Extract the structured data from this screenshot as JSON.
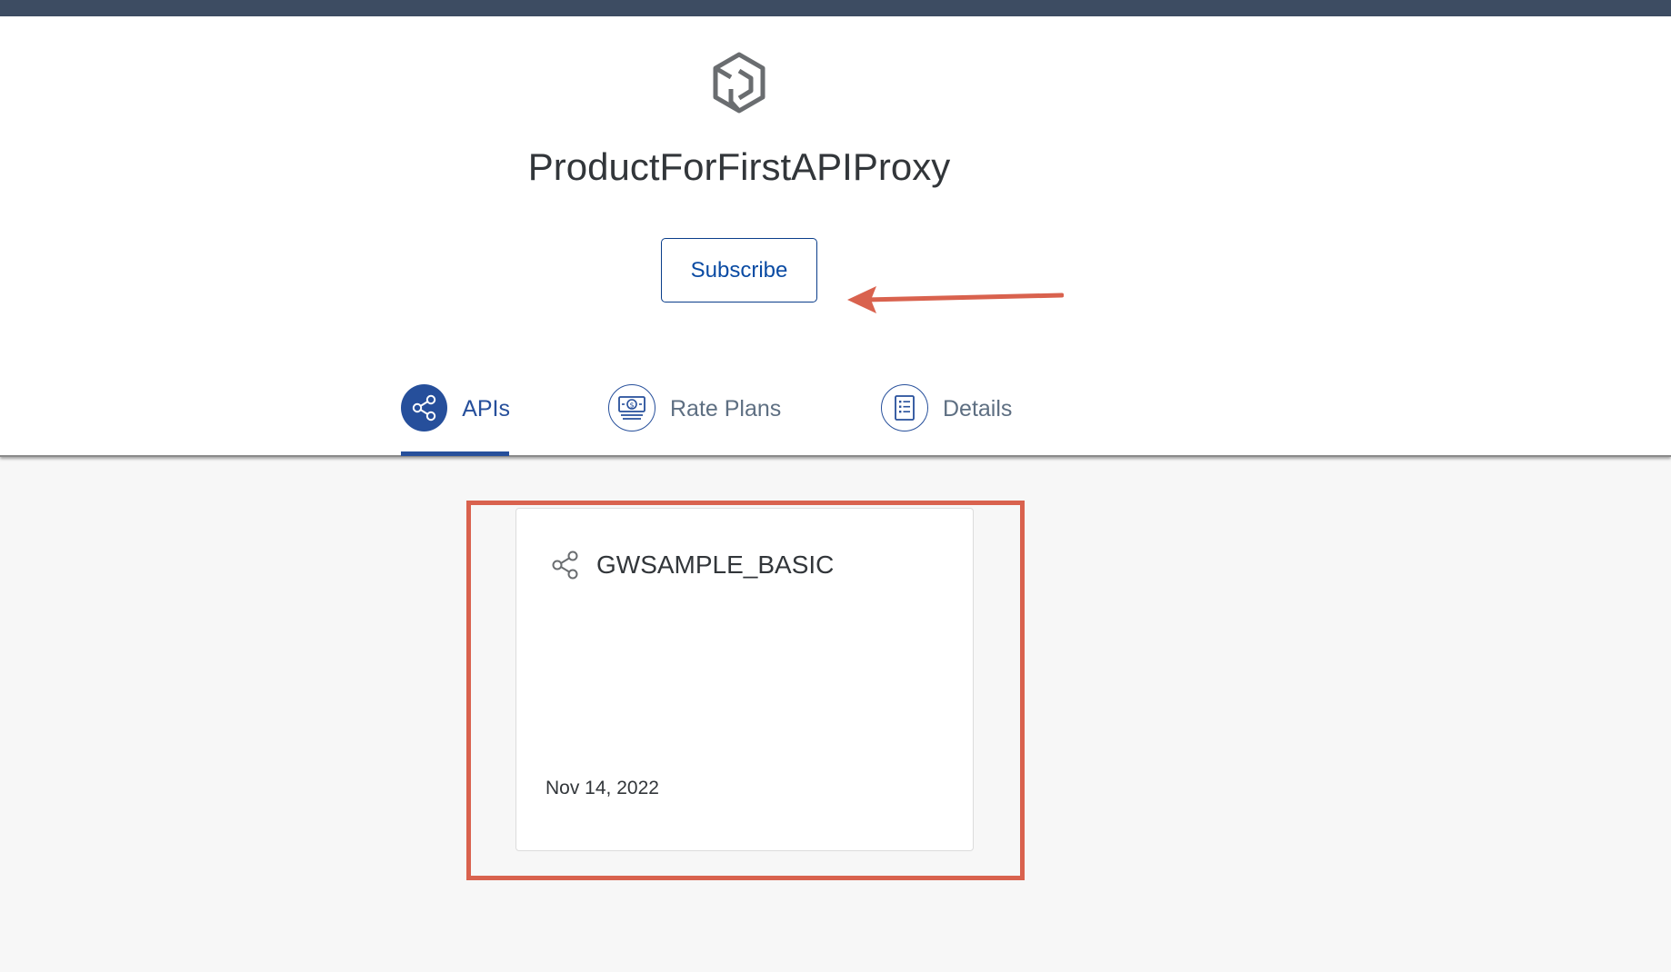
{
  "product": {
    "title": "ProductForFirstAPIProxy",
    "icon": "product-package-icon"
  },
  "actions": {
    "subscribe_label": "Subscribe"
  },
  "annotations": {
    "arrow_color": "#d9624e",
    "highlight_color": "#d9624e"
  },
  "tabs": [
    {
      "label": "APIs",
      "icon": "share-network-icon",
      "selected": true
    },
    {
      "label": "Rate Plans",
      "icon": "money-bill-icon",
      "selected": false
    },
    {
      "label": "Details",
      "icon": "document-list-icon",
      "selected": false
    }
  ],
  "api_cards": [
    {
      "title": "GWSAMPLE_BASIC",
      "icon": "share-network-icon",
      "date": "Nov 14, 2022"
    }
  ],
  "colors": {
    "top_bar": "#3d4c62",
    "accent": "#264f9b",
    "content_background": "#f7f7f7"
  }
}
